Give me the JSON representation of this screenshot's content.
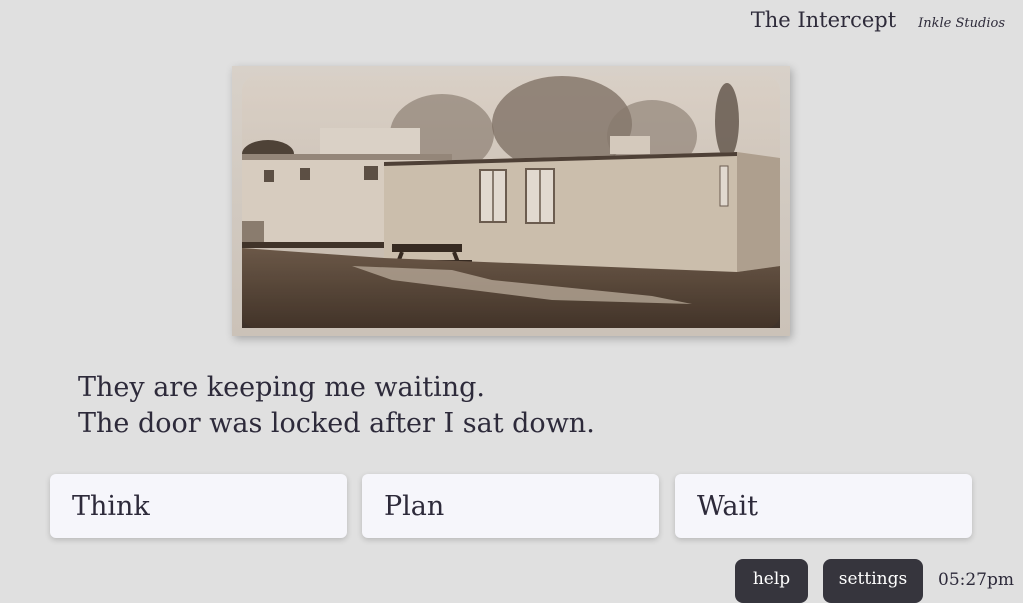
{
  "header": {
    "title": "The Intercept",
    "studio": "Inkle Studios"
  },
  "illustration": {
    "subject": "sepia photograph of a single-storey prefab building with a picnic table",
    "tone": "#8a7a6a"
  },
  "story": {
    "lines": [
      "They are keeping me waiting.",
      "The door was locked after I sat down."
    ]
  },
  "choices": [
    {
      "label": "Think"
    },
    {
      "label": "Plan"
    },
    {
      "label": "Wait"
    }
  ],
  "footer": {
    "help_label": "help",
    "settings_label": "settings",
    "time": "05:27pm"
  },
  "colors": {
    "background": "#e0e0e0",
    "text": "#2d2a3a",
    "choice_bg": "#f6f6fb",
    "button_bg": "#36353d"
  }
}
